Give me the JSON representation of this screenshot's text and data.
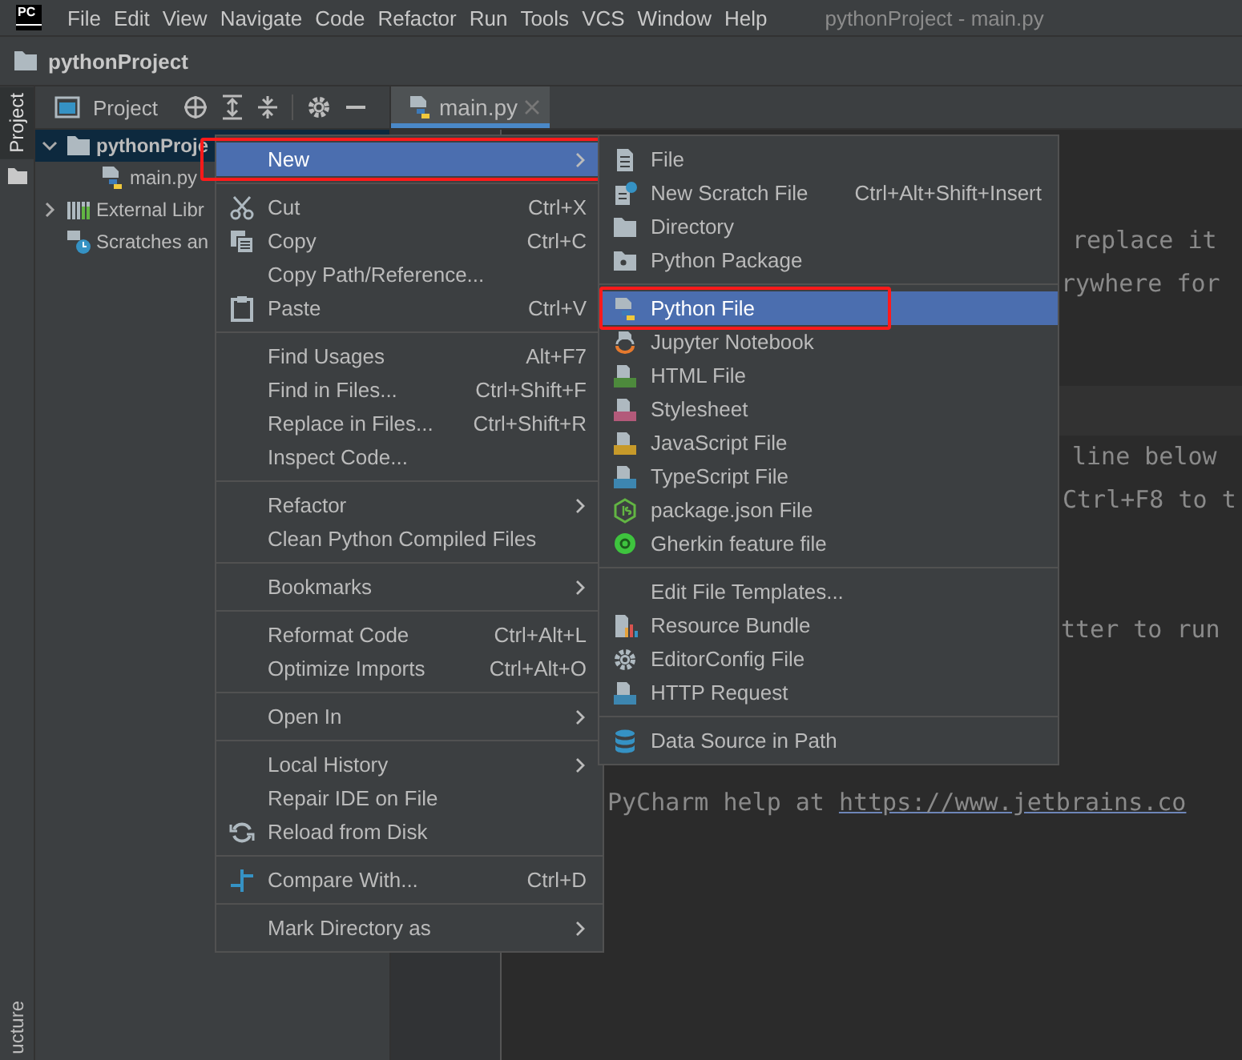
{
  "title_bar": {
    "logo": "PC",
    "menus": [
      "File",
      "Edit",
      "View",
      "Navigate",
      "Code",
      "Refactor",
      "Run",
      "Tools",
      "VCS",
      "Window",
      "Help"
    ],
    "title": "pythonProject - main.py"
  },
  "nav_bar": {
    "project": "pythonProject"
  },
  "side_strip": {
    "tabs": [
      {
        "label": "Project",
        "selected": true
      }
    ],
    "bottom_tab": "ucture"
  },
  "project_panel": {
    "title": "Project",
    "tree": [
      {
        "label": "pythonProje",
        "expanded": true,
        "selected": true,
        "children": [
          {
            "label": "main.py",
            "selected": false
          }
        ]
      },
      {
        "label": "External Libr",
        "expanded": false,
        "selected": false
      },
      {
        "label": "Scratches an",
        "selected": false
      }
    ]
  },
  "editor_tabs": [
    {
      "label": "main.py",
      "selected": true
    }
  ],
  "editor_lines": [
    {
      "text": "replace it"
    },
    {
      "text": "rywhere for"
    },
    {
      "text": "line below"
    },
    {
      "text": "Ctrl+F8 to t"
    },
    {
      "text": "tter to run"
    },
    {
      "text": "PyCharm help at",
      "link": "https://www.jetbrains.co"
    }
  ],
  "context_menu": [
    {
      "kind": "item",
      "label": "New",
      "submenu": true,
      "selected": true,
      "outlined": true
    },
    {
      "kind": "separator"
    },
    {
      "kind": "item",
      "label": "Cut",
      "shortcut": "Ctrl+X",
      "selected": false
    },
    {
      "kind": "item",
      "label": "Copy",
      "shortcut": "Ctrl+C",
      "selected": false
    },
    {
      "kind": "item",
      "label": "Copy Path/Reference...",
      "selected": false
    },
    {
      "kind": "item",
      "label": "Paste",
      "shortcut": "Ctrl+V",
      "selected": false
    },
    {
      "kind": "separator"
    },
    {
      "kind": "item",
      "label": "Find Usages",
      "shortcut": "Alt+F7",
      "selected": false
    },
    {
      "kind": "item",
      "label": "Find in Files...",
      "shortcut": "Ctrl+Shift+F",
      "selected": false
    },
    {
      "kind": "item",
      "label": "Replace in Files...",
      "shortcut": "Ctrl+Shift+R",
      "selected": false
    },
    {
      "kind": "item",
      "label": "Inspect Code...",
      "selected": false
    },
    {
      "kind": "separator"
    },
    {
      "kind": "item",
      "label": "Refactor",
      "submenu": true,
      "selected": false
    },
    {
      "kind": "item",
      "label": "Clean Python Compiled Files",
      "selected": false
    },
    {
      "kind": "separator"
    },
    {
      "kind": "item",
      "label": "Bookmarks",
      "submenu": true,
      "selected": false
    },
    {
      "kind": "separator"
    },
    {
      "kind": "item",
      "label": "Reformat Code",
      "shortcut": "Ctrl+Alt+L",
      "selected": false
    },
    {
      "kind": "item",
      "label": "Optimize Imports",
      "shortcut": "Ctrl+Alt+O",
      "selected": false
    },
    {
      "kind": "separator"
    },
    {
      "kind": "item",
      "label": "Open In",
      "submenu": true,
      "selected": false
    },
    {
      "kind": "separator"
    },
    {
      "kind": "item",
      "label": "Local History",
      "submenu": true,
      "selected": false
    },
    {
      "kind": "item",
      "label": "Repair IDE on File",
      "selected": false
    },
    {
      "kind": "item",
      "label": "Reload from Disk",
      "selected": false
    },
    {
      "kind": "separator"
    },
    {
      "kind": "item",
      "label": "Compare With...",
      "shortcut": "Ctrl+D",
      "selected": false
    },
    {
      "kind": "separator"
    },
    {
      "kind": "item",
      "label": "Mark Directory as",
      "submenu": true,
      "selected": false
    }
  ],
  "new_submenu": [
    {
      "kind": "item",
      "label": "File",
      "selected": false
    },
    {
      "kind": "item",
      "label": "New Scratch File",
      "shortcut": "Ctrl+Alt+Shift+Insert",
      "selected": false
    },
    {
      "kind": "item",
      "label": "Directory",
      "selected": false
    },
    {
      "kind": "item",
      "label": "Python Package",
      "selected": false
    },
    {
      "kind": "separator"
    },
    {
      "kind": "item",
      "label": "Python File",
      "selected": true,
      "outlined": true
    },
    {
      "kind": "item",
      "label": "Jupyter Notebook",
      "selected": false
    },
    {
      "kind": "item",
      "label": "HTML File",
      "selected": false
    },
    {
      "kind": "item",
      "label": "Stylesheet",
      "selected": false
    },
    {
      "kind": "item",
      "label": "JavaScript File",
      "selected": false
    },
    {
      "kind": "item",
      "label": "TypeScript File",
      "selected": false
    },
    {
      "kind": "item",
      "label": "package.json File",
      "selected": false
    },
    {
      "kind": "item",
      "label": "Gherkin feature file",
      "selected": false
    },
    {
      "kind": "separator"
    },
    {
      "kind": "item",
      "label": "Edit File Templates...",
      "selected": false
    },
    {
      "kind": "item",
      "label": "Resource Bundle",
      "selected": false
    },
    {
      "kind": "item",
      "label": "EditorConfig File",
      "selected": false
    },
    {
      "kind": "item",
      "label": "HTTP Request",
      "selected": false
    },
    {
      "kind": "separator"
    },
    {
      "kind": "item",
      "label": "Data Source in Path",
      "selected": false
    }
  ]
}
